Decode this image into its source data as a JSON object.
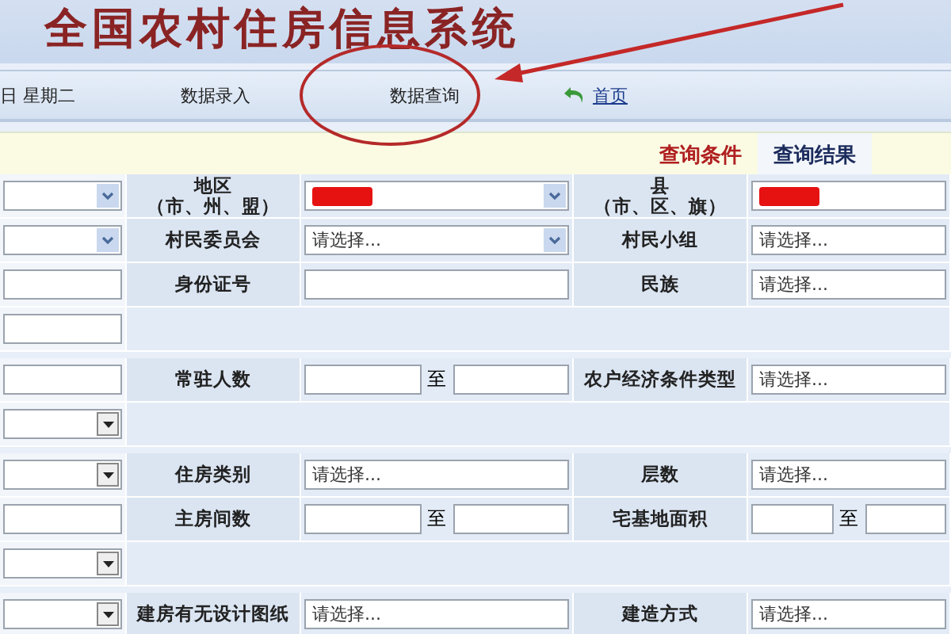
{
  "header": {
    "title": "全国农村住房信息系统"
  },
  "nav": {
    "date": "日  星期二",
    "items": [
      {
        "label": "数据录入",
        "selected": false
      },
      {
        "label": "数据查询",
        "selected": false
      }
    ],
    "home": "首页"
  },
  "tabs": [
    {
      "label": "查询条件",
      "selected": true
    },
    {
      "label": "查询结果",
      "selected": false
    }
  ],
  "rows": [
    {
      "left": {
        "kind": "chevron_select"
      },
      "cells": [
        {
          "label": "地区",
          "sublabel": "（市、州、盟）",
          "field": {
            "kind": "redacted_chevron_select"
          }
        },
        {
          "label": "县",
          "sublabel": "（市、区、旗）",
          "field": {
            "kind": "redacted"
          }
        }
      ]
    },
    {
      "left": {
        "kind": "chevron_select"
      },
      "cells": [
        {
          "label": "村民委员会",
          "field": {
            "kind": "chevron_select",
            "value": "请选择..."
          }
        },
        {
          "label": "村民小组",
          "field": {
            "kind": "select",
            "value": "请选择..."
          }
        }
      ]
    },
    {
      "left": {
        "kind": "text"
      },
      "cells": [
        {
          "label": "身份证号",
          "field": {
            "kind": "text"
          }
        },
        {
          "label": "民族",
          "field": {
            "kind": "select",
            "value": "请选择..."
          }
        }
      ]
    },
    {
      "left": {
        "kind": "text"
      },
      "cells": []
    },
    {
      "left": {
        "kind": "text"
      },
      "cells": [
        {
          "label": "常驻人数",
          "field": {
            "kind": "range",
            "separator": "至"
          }
        },
        {
          "label": "农户经济条件类型",
          "field": {
            "kind": "select",
            "value": "请选择..."
          }
        }
      ]
    },
    {
      "left": {
        "kind": "triangle_select"
      },
      "cells": []
    },
    {
      "left": {
        "kind": "triangle_select"
      },
      "cells": [
        {
          "label": "住房类别",
          "field": {
            "kind": "select",
            "value": "请选择..."
          }
        },
        {
          "label": "层数",
          "field": {
            "kind": "select",
            "value": "请选择..."
          }
        }
      ]
    },
    {
      "left": {
        "kind": "text"
      },
      "cells": [
        {
          "label": "主房间数",
          "field": {
            "kind": "range",
            "separator": "至"
          }
        },
        {
          "label": "宅基地面积",
          "field": {
            "kind": "range",
            "separator": "至"
          }
        }
      ]
    },
    {
      "left": {
        "kind": "triangle_select"
      },
      "cells": []
    },
    {
      "left": {
        "kind": "triangle_select"
      },
      "cells": [
        {
          "label": "建房有无设计图纸",
          "field": {
            "kind": "select",
            "value": "请选择..."
          }
        },
        {
          "label": "建造方式",
          "field": {
            "kind": "select",
            "value": "请选择..."
          }
        }
      ]
    }
  ]
}
